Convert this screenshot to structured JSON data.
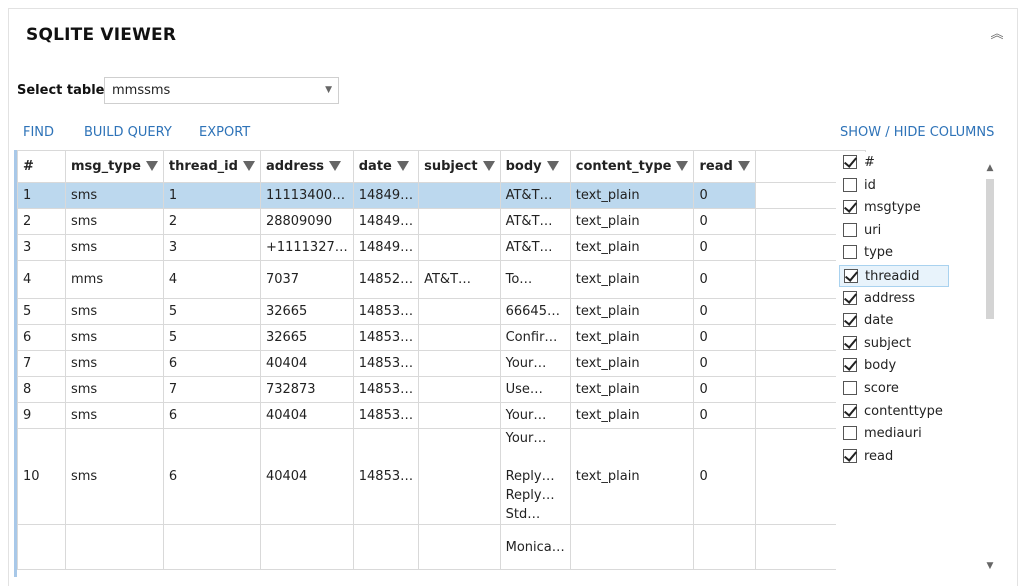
{
  "panel": {
    "title": "SQLITE VIEWER"
  },
  "select": {
    "label": "Select table",
    "value": "mmssms"
  },
  "toolbar": {
    "find": "FIND",
    "build_query": "BUILD QUERY",
    "export": "EXPORT",
    "show_hide": "SHOW / HIDE COLUMNS"
  },
  "grid": {
    "headers": [
      "#",
      "msg_type",
      "thread_id",
      "address",
      "date",
      "subject",
      "body",
      "content_type",
      "read"
    ],
    "rows": [
      [
        "1",
        "sms",
        "1",
        "11113400…",
        "14849…",
        "",
        "AT&T…",
        "text_plain",
        "0"
      ],
      [
        "2",
        "sms",
        "2",
        "28809090",
        "14849…",
        "",
        "AT&T…",
        "text_plain",
        "0"
      ],
      [
        "3",
        "sms",
        "3",
        "+1111327…",
        "14849…",
        "",
        "AT&T…",
        "text_plain",
        "0"
      ],
      [
        "4",
        "mms",
        "4",
        "7037",
        "14852…",
        "AT&T…",
        "To…",
        "text_plain",
        "0"
      ],
      [
        "5",
        "sms",
        "5",
        "32665",
        "14853…",
        "",
        "66645…",
        "text_plain",
        "0"
      ],
      [
        "6",
        "sms",
        "5",
        "32665",
        "14853…",
        "",
        "Confir…",
        "text_plain",
        "0"
      ],
      [
        "7",
        "sms",
        "6",
        "40404",
        "14853…",
        "",
        "Your…",
        "text_plain",
        "0"
      ],
      [
        "8",
        "sms",
        "7",
        "732873",
        "14853…",
        "",
        "Use…",
        "text_plain",
        "0"
      ],
      [
        "9",
        "sms",
        "6",
        "40404",
        "14853…",
        "",
        "Your…",
        "text_plain",
        "0"
      ],
      [
        "10",
        "sms",
        "6",
        "40404",
        "14853…",
        "",
        "Your…\n\nReply…\nReply…\nStd…",
        "text_plain",
        "0"
      ],
      [
        "",
        "",
        "",
        "",
        "",
        "",
        "Monica…",
        "",
        ""
      ]
    ]
  },
  "columns": [
    {
      "label": "#",
      "checked": true
    },
    {
      "label": "id",
      "checked": false
    },
    {
      "label": "msgtype",
      "checked": true
    },
    {
      "label": "uri",
      "checked": false
    },
    {
      "label": "type",
      "checked": false
    },
    {
      "label": "threadid",
      "checked": true
    },
    {
      "label": "address",
      "checked": true
    },
    {
      "label": "date",
      "checked": true
    },
    {
      "label": "subject",
      "checked": true
    },
    {
      "label": "body",
      "checked": true
    },
    {
      "label": "score",
      "checked": false
    },
    {
      "label": "contenttype",
      "checked": true
    },
    {
      "label": "mediauri",
      "checked": false
    },
    {
      "label": "read",
      "checked": true
    }
  ],
  "colors": {
    "accent": "#2e73b8",
    "selected_row": "#bcd8ee",
    "hover_item": "#e8f3fb"
  }
}
